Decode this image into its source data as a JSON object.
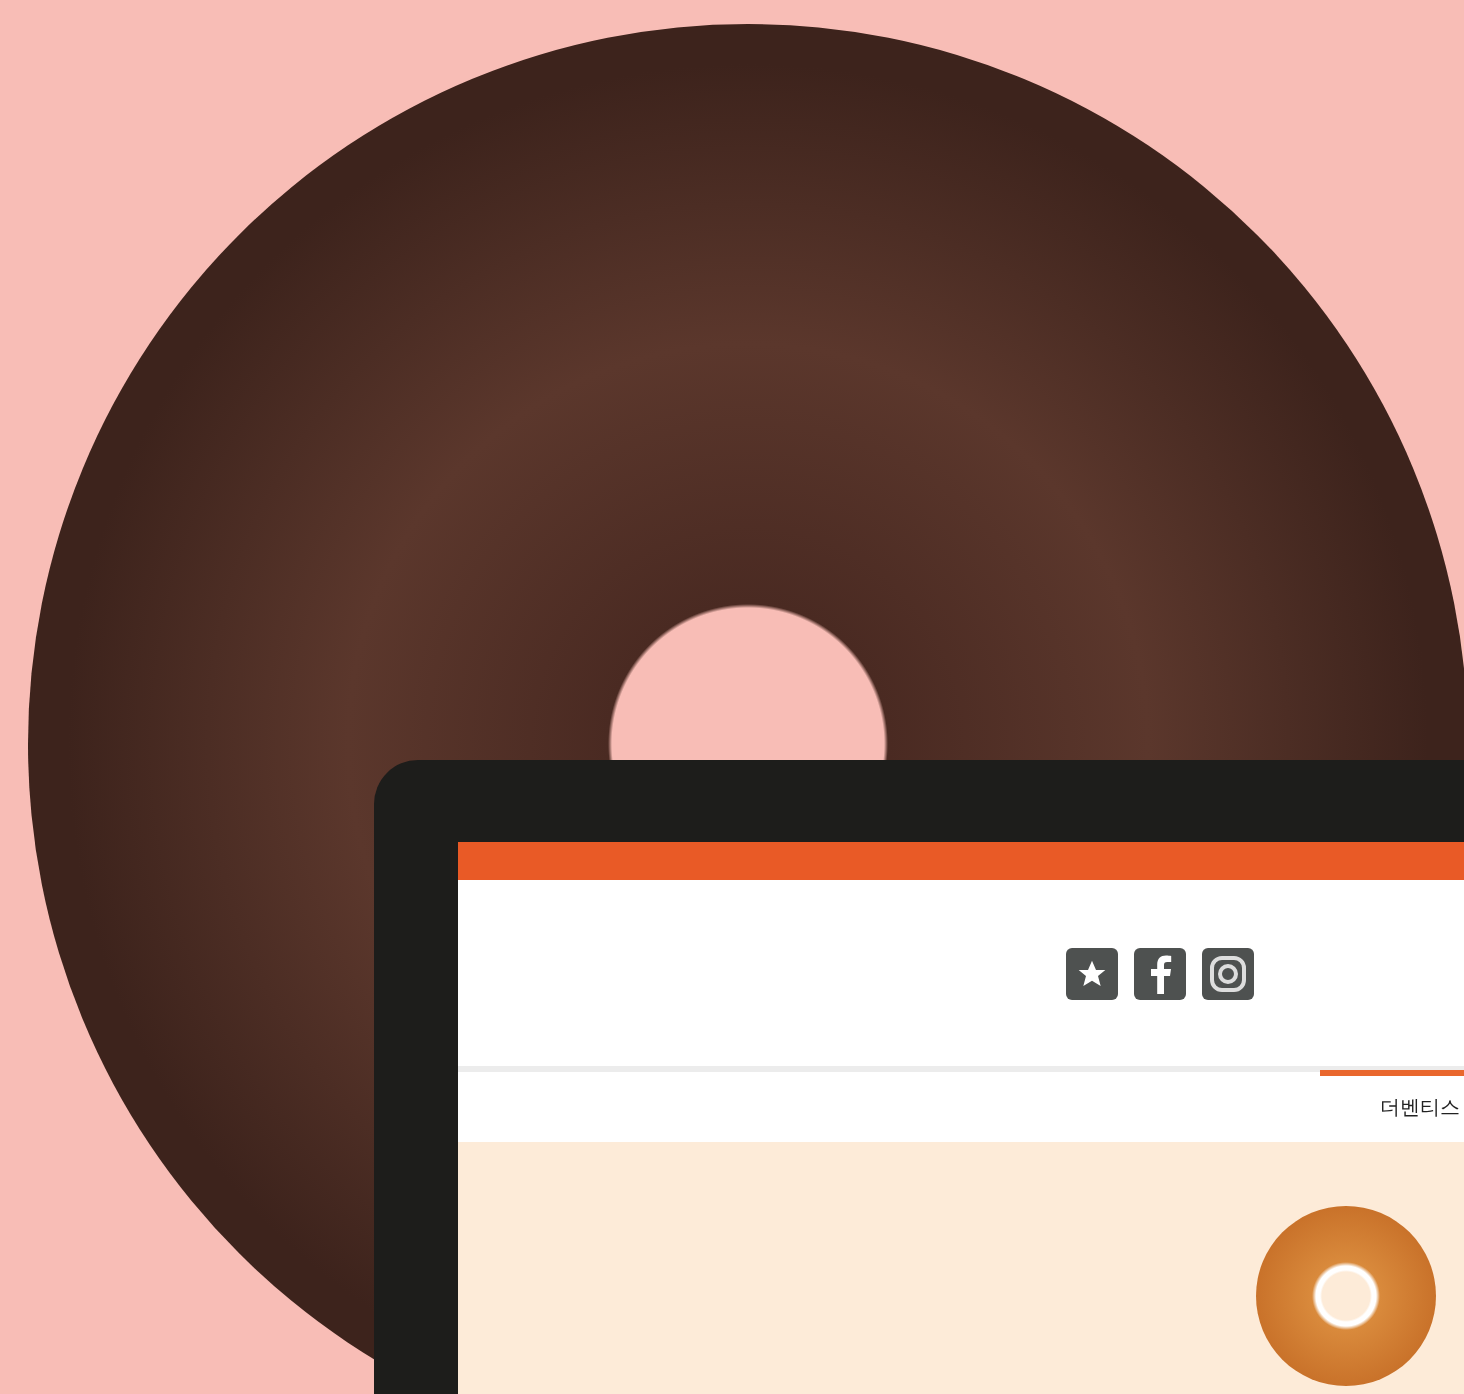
{
  "header": {
    "social_icons": [
      {
        "kind": "star"
      },
      {
        "kind": "facebook"
      },
      {
        "kind": "instagram"
      }
    ]
  },
  "nav": {
    "tabs": [
      {
        "label": "더벤티스",
        "selected": true
      }
    ]
  }
}
